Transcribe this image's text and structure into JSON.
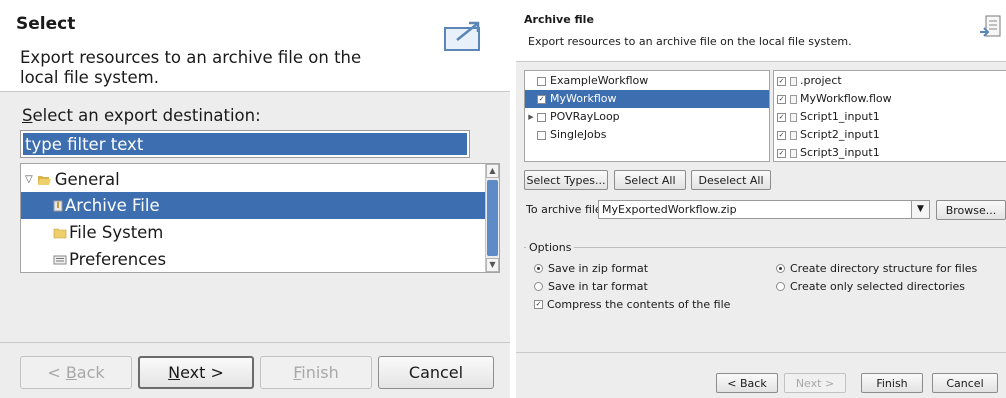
{
  "left": {
    "title": "Select",
    "description": "Export resources to an archive file on the local file system.",
    "dest_label_mnemonic": "S",
    "dest_label_rest": "elect an export destination:",
    "filter_placeholder": "type filter text",
    "tree": {
      "root": "General",
      "children": [
        "Archive File",
        "File System",
        "Preferences"
      ],
      "selected": "Archive File"
    },
    "buttons": {
      "back_prefix": "< ",
      "back_mnemonic": "B",
      "back_rest": "ack",
      "next_mnemonic": "N",
      "next_rest": "ext >",
      "finish_mnemonic": "F",
      "finish_rest": "inish",
      "cancel": "Cancel"
    }
  },
  "right": {
    "title": "Archive file",
    "description": "Export resources to an archive file on the local file system.",
    "projects": [
      {
        "name": "ExampleWorkflow",
        "checked": false,
        "expandable": false
      },
      {
        "name": "MyWorkflow",
        "checked": true,
        "expandable": false,
        "selected": true
      },
      {
        "name": "POVRayLoop",
        "checked": false,
        "expandable": true
      },
      {
        "name": "SingleJobs",
        "checked": false,
        "expandable": false
      }
    ],
    "files": [
      {
        "name": ".project",
        "checked": true
      },
      {
        "name": "MyWorkflow.flow",
        "checked": true
      },
      {
        "name": "Script1_input1",
        "checked": true
      },
      {
        "name": "Script2_input1",
        "checked": true
      },
      {
        "name": "Script3_input1",
        "checked": true
      }
    ],
    "buttons": {
      "select_types": "Select Types...",
      "select_all": "Select All",
      "deselect_all": "Deselect All",
      "browse": "Browse...",
      "back": "< Back",
      "next": "Next >",
      "finish": "Finish",
      "cancel": "Cancel"
    },
    "archive_label": "To archive file:",
    "archive_value": "MyExportedWorkflow.zip",
    "options_label": "Options",
    "options": {
      "save_zip": "Save in zip format",
      "save_tar": "Save in tar format",
      "compress": "Compress the contents of the file",
      "create_dirs": "Create directory structure for files",
      "create_selected": "Create only selected directories"
    }
  }
}
